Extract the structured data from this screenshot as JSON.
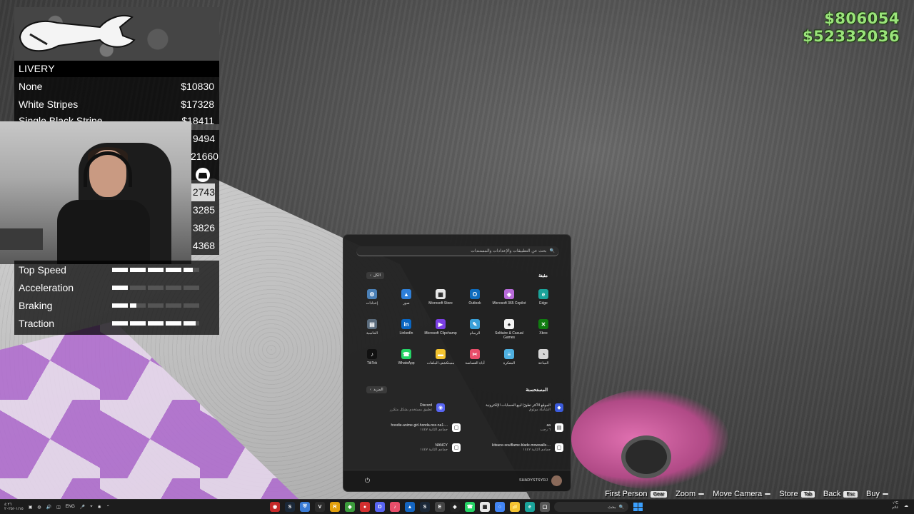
{
  "hud": {
    "money_cash": "$806054",
    "money_bank": "$52332036"
  },
  "menu": {
    "header": "LIVERY",
    "items": [
      {
        "label": "None",
        "price": "$10830"
      },
      {
        "label": "White Stripes",
        "price": "$17328"
      },
      {
        "label": "Single Black Stripe",
        "price": "$18411"
      }
    ],
    "hidden_prices": [
      "9494",
      "21660",
      "",
      "2743",
      "3285",
      "3826",
      "4368"
    ],
    "selected_index": 3
  },
  "stats": [
    {
      "label": "Top Speed",
      "level": 0.92,
      "upgrade": 0.92
    },
    {
      "label": "Acceleration",
      "level": 0.2,
      "upgrade": 0.95
    },
    {
      "label": "Braking",
      "level": 0.28,
      "upgrade": 0.9
    },
    {
      "label": "Traction",
      "level": 0.95,
      "upgrade": 0.95
    }
  ],
  "start_menu": {
    "search_placeholder": "بحث عن التطبيقات والإعدادات والمستندات",
    "pinned_title": "مثبتة",
    "all_label": "الكل",
    "recommended_title": "المستحسنة",
    "more_label": "المزيد",
    "user_name": "SHADYSTSYRJ",
    "apps": [
      {
        "label": "إعدادات",
        "icon": "settings-icon",
        "color": "#4a7fb5"
      },
      {
        "label": "صور",
        "icon": "photos-icon",
        "color": "#2f7fd8"
      },
      {
        "label": "Microsoft Store",
        "icon": "store-icon",
        "color": "#e8e8e8"
      },
      {
        "label": "Outlook",
        "icon": "outlook-icon",
        "color": "#0f6cbd"
      },
      {
        "label": "Microsoft 365 Copilot",
        "icon": "copilot-icon",
        "color": "#b86ad9"
      },
      {
        "label": "Edge",
        "icon": "edge-icon",
        "color": "#1aa39a"
      },
      {
        "label": "الحاسبة",
        "icon": "calculator-icon",
        "color": "#5a6b7c"
      },
      {
        "label": "LinkedIn",
        "icon": "linkedin-icon",
        "color": "#0a66c2"
      },
      {
        "label": "Microsoft Clipchamp",
        "icon": "clipchamp-icon",
        "color": "#7b3fe4"
      },
      {
        "label": "الرسام",
        "icon": "paint-icon",
        "color": "#3aa0d8"
      },
      {
        "label": "Solitaire & Casual Games",
        "icon": "solitaire-icon",
        "color": "#f2f2f2"
      },
      {
        "label": "Xbox",
        "icon": "xbox-icon",
        "color": "#107c10"
      },
      {
        "label": "TikTok",
        "icon": "tiktok-icon",
        "color": "#111111"
      },
      {
        "label": "WhatsApp",
        "icon": "whatsapp-icon",
        "color": "#25d366"
      },
      {
        "label": "مستكشف الملفات",
        "icon": "folder-icon",
        "color": "#f4c430"
      },
      {
        "label": "أداة القصاصة",
        "icon": "snipping-tool-icon",
        "color": "#e84e6a"
      },
      {
        "label": "المفكرة",
        "icon": "notepad-icon",
        "color": "#4fb0e0"
      },
      {
        "label": "الساعة",
        "icon": "clock-icon",
        "color": "#d8d8d8"
      }
    ],
    "recommended": [
      {
        "title": "Discord",
        "subtitle": "تطبيق مستخدم بشكل متكرر",
        "icon": "discord-icon",
        "color": "#5865f2"
      },
      {
        "title": "الموقع الأكثر تطورًا لبيع الحسابات الإلكترونية",
        "subtitle": "الشاملة موثوق",
        "icon": "site-icon",
        "color": "#3b5bdb"
      },
      {
        "title": "hoodie-anime-girl-honda-nsx-na1-...",
        "subtitle": "جمادى الثانية ١٤٤٧",
        "icon": "file-icon",
        "color": "#ffffff"
      },
      {
        "title": "aa",
        "subtitle": "٦ رجب",
        "icon": "document-icon",
        "color": "#ffffff"
      },
      {
        "title": "NANCY",
        "subtitle": "جمادى الثانية ١٤٤٧",
        "icon": "file-icon",
        "color": "#ffffff"
      },
      {
        "title": "kitsune-soulflame-blade-mowwalls-...",
        "subtitle": "جمادى الثانية ١٤٤٧",
        "icon": "file-icon",
        "color": "#ffffff"
      }
    ]
  },
  "hints": [
    {
      "label": "First Person",
      "key": "Gear"
    },
    {
      "label": "Zoom",
      "key": ""
    },
    {
      "label": "Move Camera",
      "key": ""
    },
    {
      "label": "Store",
      "key": "Tab"
    },
    {
      "label": "Back",
      "key": "Esc"
    },
    {
      "label": "Buy",
      "key": ""
    }
  ],
  "taskbar": {
    "time": "٤:٢٦",
    "date": "٢٠٢٥/٠١/١٥",
    "lang": "ENG",
    "search_label": "بحث",
    "weather": "١°C",
    "weather_desc": "غائم"
  }
}
